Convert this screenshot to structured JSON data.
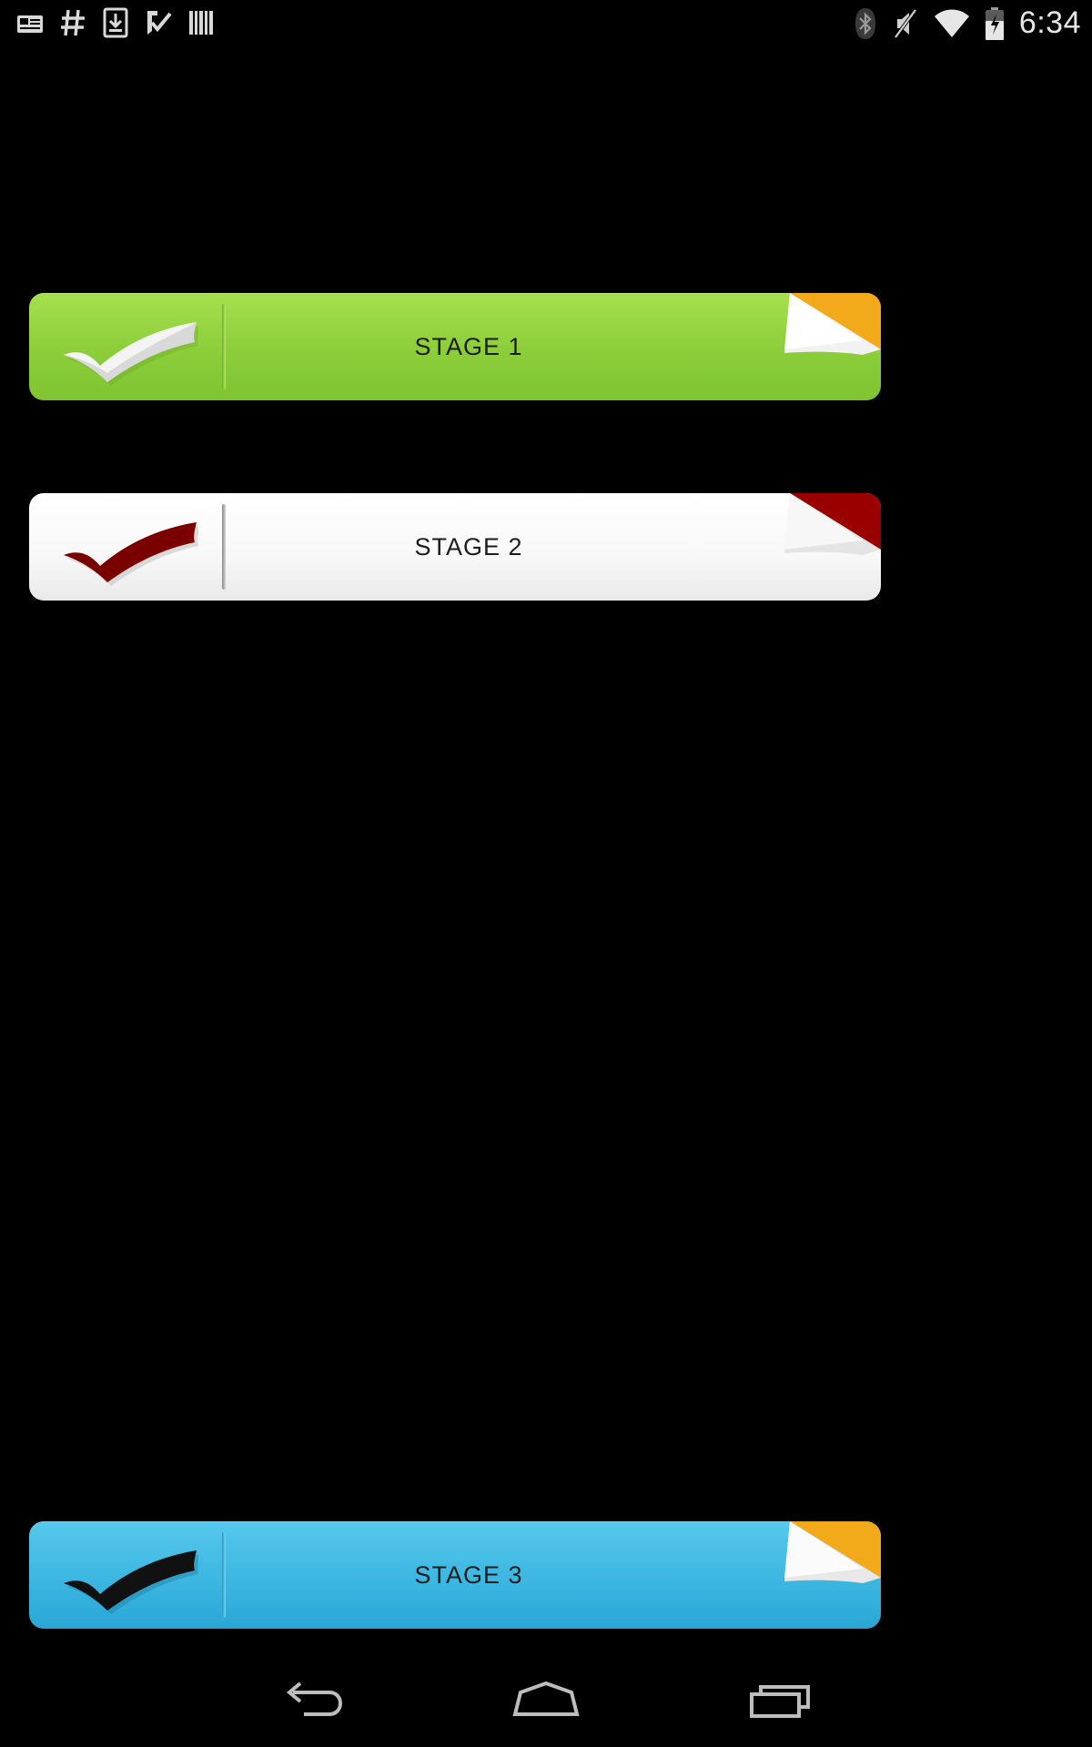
{
  "status_bar": {
    "left_icons": [
      "news-icon",
      "hashtag-icon",
      "download-icon",
      "task-check-icon",
      "barcode-icon"
    ],
    "right_icons": [
      "bluetooth-icon",
      "mute-icon",
      "wifi-icon",
      "battery-icon"
    ],
    "time": "6:34"
  },
  "stages": [
    {
      "label": "STAGE 1",
      "color": "#8ccd3a",
      "check_color": "#d9d9d9",
      "corner_color": "#f2a91a"
    },
    {
      "label": "STAGE 2",
      "color": "#ffffff",
      "check_color": "#7a0000",
      "corner_color": "#9b0000"
    },
    {
      "label": "STAGE 3",
      "color": "#3cb7e1",
      "check_color": "#111111",
      "corner_color": "#f2a91a"
    }
  ],
  "nav_bar": {
    "icons": [
      "back-icon",
      "home-icon",
      "recents-icon"
    ]
  }
}
